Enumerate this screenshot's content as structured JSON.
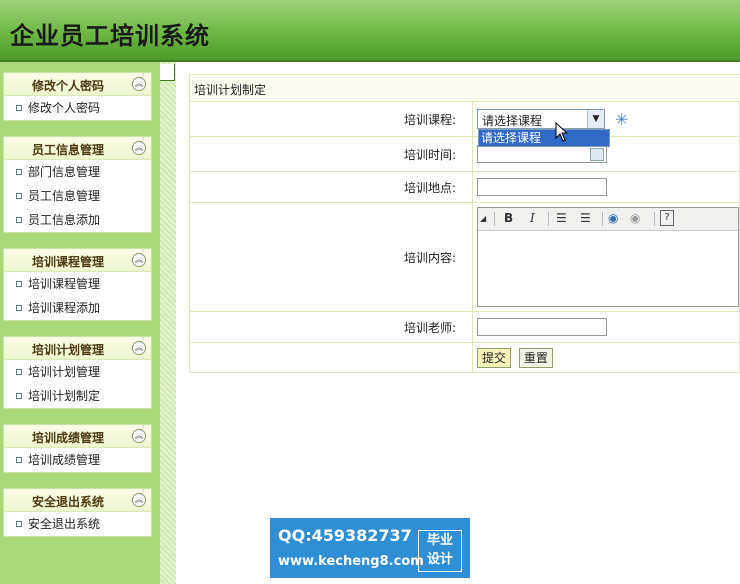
{
  "header": {
    "title": "企业员工培训系统"
  },
  "sidebar": {
    "panels": [
      {
        "title": "修改个人密码",
        "items": [
          "修改个人密码"
        ]
      },
      {
        "title": "员工信息管理",
        "items": [
          "部门信息管理",
          "员工信息管理",
          "员工信息添加"
        ]
      },
      {
        "title": "培训课程管理",
        "items": [
          "培训课程管理",
          "培训课程添加"
        ]
      },
      {
        "title": "培训计划管理",
        "items": [
          "培训计划管理",
          "培训计划制定"
        ]
      },
      {
        "title": "培训成绩管理",
        "items": [
          "培训成绩管理"
        ]
      },
      {
        "title": "安全退出系统",
        "items": [
          "安全退出系统"
        ]
      }
    ]
  },
  "main": {
    "breadcrumb": "培训计划制定",
    "form": {
      "course_label": "培训课程:",
      "course_selected": "请选择课程",
      "course_dropdown_option": "请选择课程",
      "time_label": "培训时间:",
      "time_value": "",
      "place_label": "培训地点:",
      "place_value": "",
      "content_label": "培训内容:",
      "content_value": "",
      "teacher_label": "培训老师:",
      "teacher_value": "",
      "submit_label": "提交",
      "reset_label": "重置"
    }
  },
  "watermark": {
    "qq": "QQ:459382737",
    "url": "www.kecheng8.com",
    "badge_line1": "毕业",
    "badge_line2": "设计"
  },
  "colors": {
    "header_green": "#6cb845",
    "sidebar_bg": "#a8d878",
    "selection_blue": "#3169c6"
  }
}
